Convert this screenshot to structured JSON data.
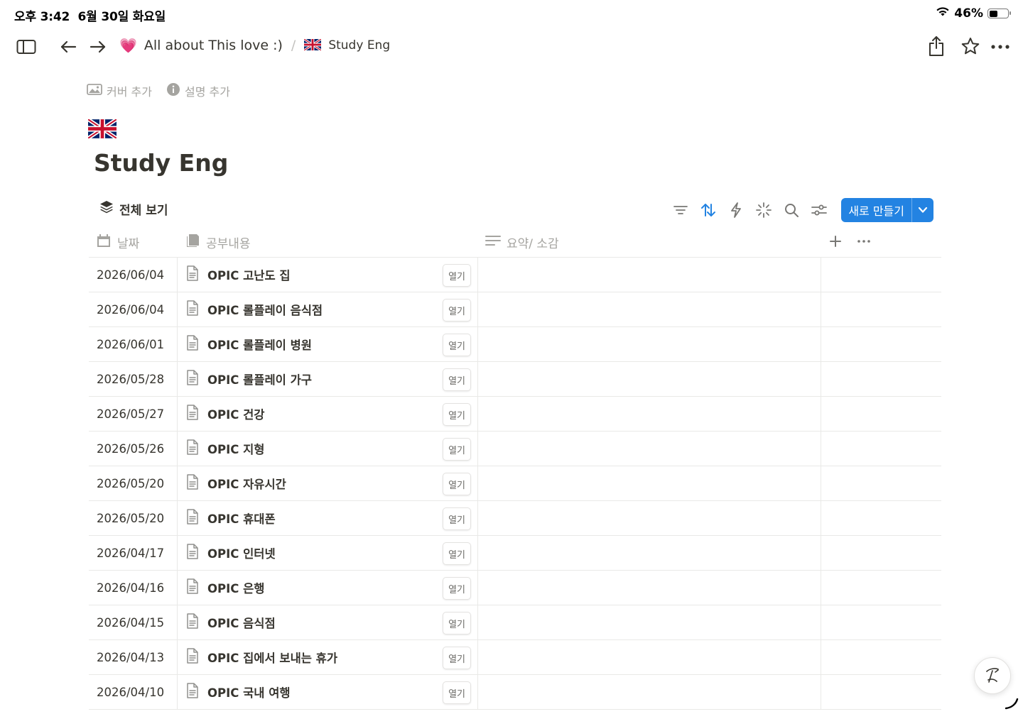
{
  "status": {
    "time": "오후 3:42",
    "date": "6월 30일 화요일",
    "battery": "46%",
    "battery_level": 0.46
  },
  "breadcrumb": {
    "parent": {
      "emoji": "💗",
      "label": "All about This love :)"
    },
    "separator": "/",
    "current": {
      "emoji": "🇬🇧",
      "label": "Study Eng"
    }
  },
  "page_actions": {
    "cover": "커버 추가",
    "description": "설명 추가"
  },
  "page": {
    "title": "Study Eng"
  },
  "view": {
    "label": "전체 보기"
  },
  "toolbar": {
    "new_label": "새로 만들기",
    "accent": "#2383e2"
  },
  "columns": {
    "date": "날짜",
    "title": "공부내용",
    "summary": "요약/ 소감"
  },
  "open_label": "열기",
  "rows": [
    {
      "date": "2026/06/04",
      "title": "OPIC 고난도 집"
    },
    {
      "date": "2026/06/04",
      "title": "OPIC 롤플레이 음식점"
    },
    {
      "date": "2026/06/01",
      "title": "OPIC 롤플레이 병원"
    },
    {
      "date": "2026/05/28",
      "title": "OPIC 롤플레이 가구"
    },
    {
      "date": "2026/05/27",
      "title": "OPIC 건강"
    },
    {
      "date": "2026/05/26",
      "title": "OPIC 지형"
    },
    {
      "date": "2026/05/20",
      "title": "OPIC 자유시간"
    },
    {
      "date": "2026/05/20",
      "title": "OPIC 휴대폰"
    },
    {
      "date": "2026/04/17",
      "title": "OPIC 인터넷"
    },
    {
      "date": "2026/04/16",
      "title": "OPIC 은행"
    },
    {
      "date": "2026/04/15",
      "title": "OPIC 음식점"
    },
    {
      "date": "2026/04/13",
      "title": " OPIC 집에서 보내는 휴가"
    },
    {
      "date": "2026/04/10",
      "title": "OPIC 국내 여행"
    }
  ]
}
